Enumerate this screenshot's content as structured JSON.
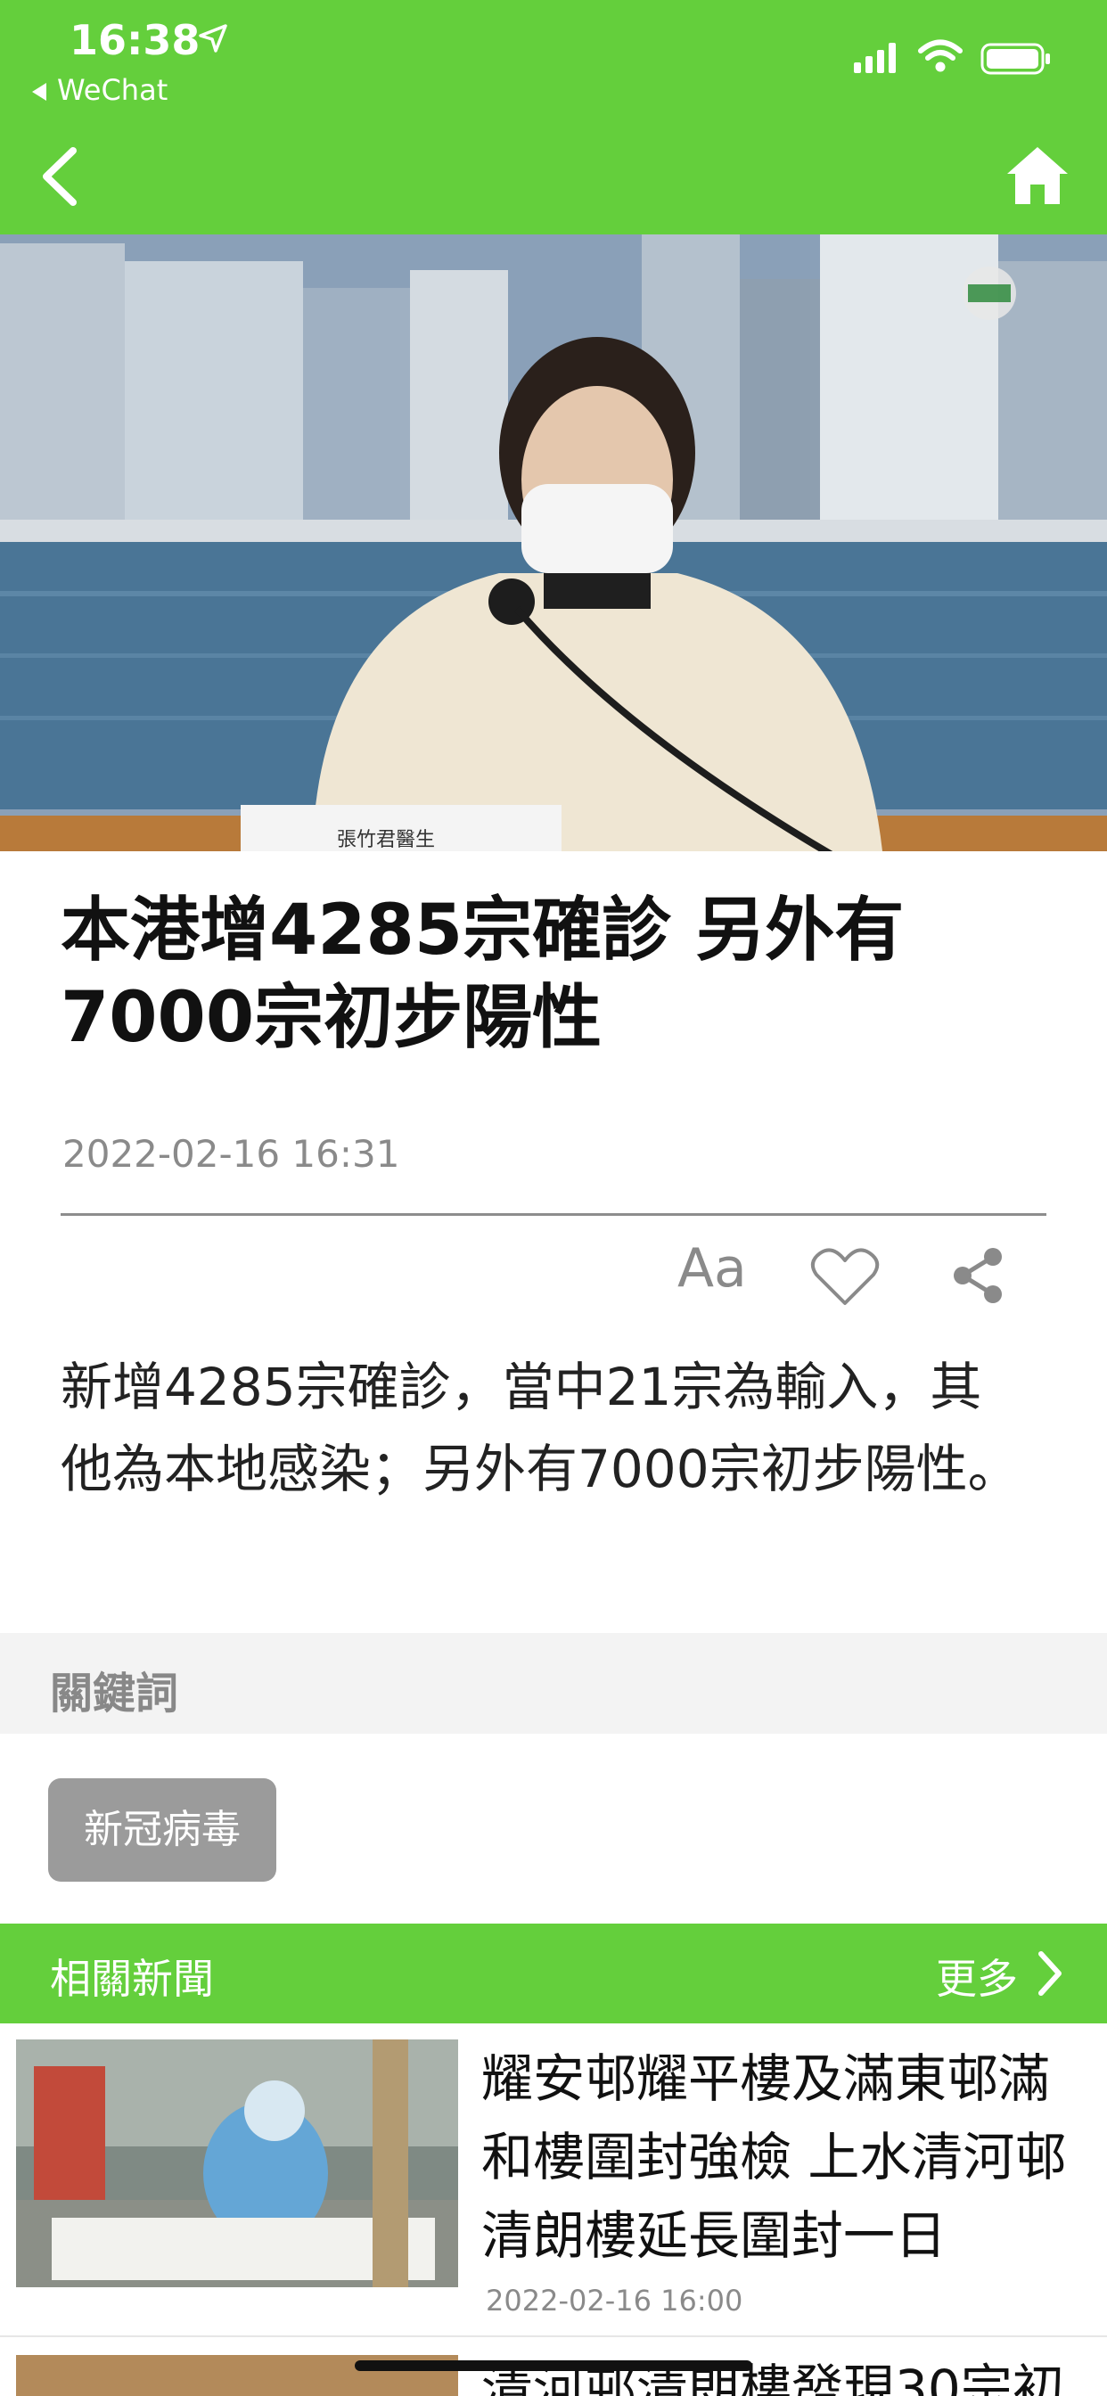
{
  "status_bar": {
    "time": "16:38",
    "back_app_label": "WeChat"
  },
  "icons": {
    "location": "location-arrow-icon",
    "signal": "cellular-signal-icon",
    "wifi": "wifi-icon",
    "battery": "battery-icon",
    "back": "chevron-left-icon",
    "home": "home-icon",
    "font_size": "font-size-icon",
    "favorite": "heart-icon",
    "share": "share-icon",
    "more": "chevron-right-icon"
  },
  "colors": {
    "brand_green": "#64cf3c",
    "tag_gray": "#9b9b9b"
  },
  "article": {
    "caption_on_photo": "張竹君醫生",
    "title": "本港增4285宗確診 另外有7000宗初步陽性",
    "date": "2022-02-16 16:31",
    "font_tool_label": "Aa",
    "summary": "新增4285宗確診，當中21宗為輸入，其他為本地感染；另外有7000宗初步陽性。"
  },
  "keywords": {
    "label": "關鍵詞",
    "tags": [
      "新冠病毒"
    ]
  },
  "related": {
    "label": "相關新聞",
    "more_label": "更多",
    "items": [
      {
        "title": "耀安邨耀平樓及滿東邨滿和樓圍封強檢 上水清河邨清朗樓延長圍封一日",
        "date": "2022-02-16 16:00"
      },
      {
        "title": "清河邨清朗樓發現30宗初"
      }
    ]
  }
}
